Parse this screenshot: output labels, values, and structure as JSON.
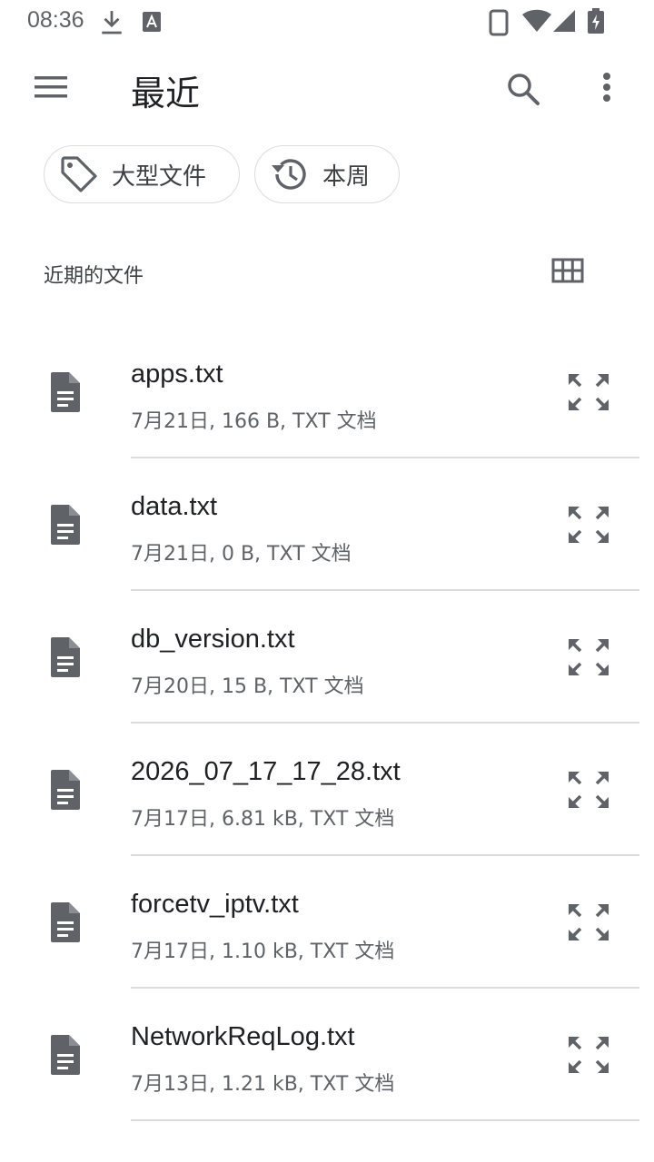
{
  "status_bar": {
    "time": "08:36",
    "icons": [
      "download-icon",
      "a-notification-icon",
      "phone-icon",
      "wifi-icon",
      "signal-icon",
      "battery-charging-icon"
    ]
  },
  "toolbar": {
    "title": "最近",
    "icons": [
      "menu-icon",
      "search-icon",
      "more-vert-icon"
    ]
  },
  "chips": [
    {
      "label": "大型文件",
      "icon": "tag-icon"
    },
    {
      "label": "本周",
      "icon": "history-icon"
    }
  ],
  "section": {
    "title": "近期的文件",
    "view_toggle_icon": "grid-view-icon"
  },
  "files": [
    {
      "name": "apps.txt",
      "meta": "7月21日, 166 B, TXT 文档"
    },
    {
      "name": "data.txt",
      "meta": "7月21日, 0 B, TXT 文档"
    },
    {
      "name": "db_version.txt",
      "meta": "7月20日, 15 B, TXT 文档"
    },
    {
      "name": "2026_07_17_17_28.txt",
      "meta": "7月17日, 6.81 kB, TXT 文档"
    },
    {
      "name": "forcetv_iptv.txt",
      "meta": "7月17日, 1.10 kB, TXT 文档"
    },
    {
      "name": "NetworkReqLog.txt",
      "meta": "7月13日, 1.21 kB, TXT 文档"
    }
  ],
  "colors": {
    "icon_gray": "#5f6368",
    "text_primary": "#202124",
    "text_secondary": "#5f6368",
    "divider": "#dadce0"
  }
}
